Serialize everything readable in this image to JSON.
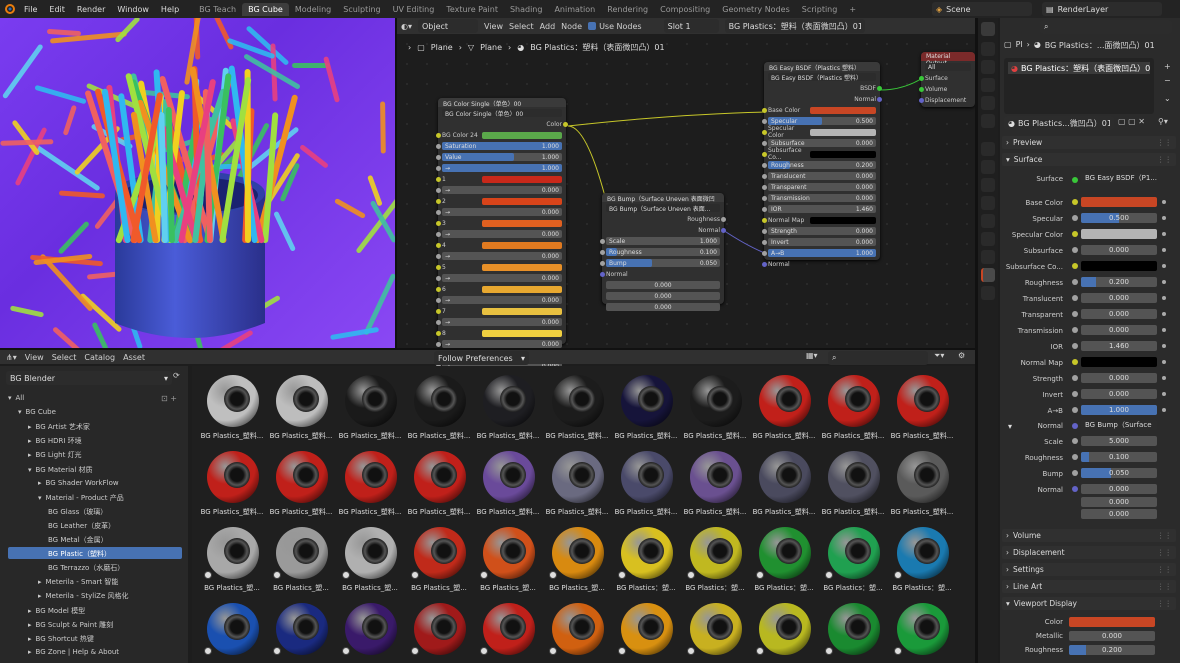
{
  "topbar": {
    "menus": [
      "File",
      "Edit",
      "Render",
      "Window",
      "Help"
    ],
    "tabs": [
      "BG Teach",
      "BG Cube",
      "Modeling",
      "Sculpting",
      "UV Editing",
      "Texture Paint",
      "Shading",
      "Animation",
      "Rendering",
      "Compositing",
      "Geometry Nodes",
      "Scripting"
    ],
    "add_tab": "+",
    "scene": "Scene",
    "render_layer": "RenderLayer"
  },
  "node_header": {
    "object_mode": "Object",
    "view": "View",
    "select": "Select",
    "add": "Add",
    "node": "Node",
    "use_nodes": "Use Nodes",
    "slot": "Slot 1",
    "material": "BG Plastics：塑料（表面微凹凸）01"
  },
  "breadcrumb": [
    "Plane",
    "Plane",
    "BG Plastics：塑料（表面微凹凸）01"
  ],
  "nodes": {
    "color_single": {
      "title": "BG Color Single（单色）00",
      "sub": "BG Color Single（单色）00",
      "out": "Color",
      "color_label": "BG Color 24",
      "rows": [
        [
          "Saturation",
          "1.000"
        ],
        [
          "Value",
          "1.000"
        ],
        [
          "→",
          "1.000"
        ]
      ],
      "idx": [
        "1",
        "2",
        "3",
        "4",
        "5",
        "6",
        "7",
        "8",
        "9"
      ],
      "zero": "0.000"
    },
    "bump": {
      "title": "BG Bump（Surface Uneven 表面微凹凸）",
      "sub": "BG Bump（Surface Uneven 表面...",
      "out1": "Roughness",
      "out2": "Normal",
      "rows": [
        [
          "Scale",
          "1.000"
        ],
        [
          "Roughness",
          "0.100"
        ],
        [
          "Bump",
          "0.050"
        ]
      ],
      "normal": "Normal",
      "n1": "0.000",
      "n2": "0.000",
      "n3": "0.000"
    },
    "bsdf": {
      "title": "BG Easy BSDF（Plastics 塑料）",
      "sub": "BG Easy BSDF（Plastics 塑料）",
      "out1": "BSDF",
      "out2": "Normal",
      "rows": [
        [
          "Base Color",
          ""
        ],
        [
          "Specular",
          "0.500"
        ],
        [
          "Specular Color",
          ""
        ],
        [
          "Subsurface",
          "0.000"
        ],
        [
          "Subsurface Co...",
          ""
        ],
        [
          "Roughness",
          "0.200"
        ],
        [
          "Translucent",
          "0.000"
        ],
        [
          "Transparent",
          "0.000"
        ],
        [
          "Transmission",
          "0.000"
        ],
        [
          "IOR",
          "1.460"
        ],
        [
          "Normal Map",
          ""
        ],
        [
          "Strength",
          "0.000"
        ],
        [
          "Invert",
          "0.000"
        ],
        [
          "A→B",
          "1.000"
        ],
        [
          "Normal",
          ""
        ]
      ]
    },
    "output": {
      "title": "Material Output",
      "target": "All",
      "s1": "Surface",
      "s2": "Volume",
      "s3": "Displacement"
    }
  },
  "asset_header": {
    "view": "View",
    "select": "Select",
    "catalog": "Catalog",
    "asset": "Asset",
    "follow": "Follow Preferences"
  },
  "asset_side": {
    "library": "BG Blender",
    "tree": [
      "All",
      "BG Cube",
      "BG Artist 艺术家",
      "BG HDRI 环境",
      "BG Light 灯光",
      "BG Material 材质",
      "BG Shader WorkFlow",
      "Material - Product 产品",
      "BG Glass（玻璃）",
      "BG Leather（皮革）",
      "BG Metal（金属）",
      "BG Plastic（塑料）",
      "BG Terrazzo（水磨石）",
      "Meterila - Smart 智能",
      "Meterila - StyliZe 风格化",
      "BG Model 模型",
      "BG Sculpt & Paint 雕刻",
      "BG Shortcut 热键",
      "BG Zone | Help & About"
    ]
  },
  "assets": {
    "long_label": "BG Plastics_塑料...",
    "short_label": "BG Plastics_塑...",
    "colon_label": "BG Plastics：塑...",
    "colors": [
      "#bfbfbf",
      "#bdbdbd",
      "#1a1a1a",
      "#1a1a1a",
      "#1e1e22",
      "#1c1c1c",
      "#16143a",
      "#1c1c1c",
      "#c1201a",
      "#c0201a",
      "#c0201a",
      "#c0201a",
      "#c0201a",
      "#c0201a",
      "#c0201a",
      "#6a4a9a",
      "#6a6a80",
      "#4a4a6a",
      "#6a5090",
      "#4a4a5e",
      "#505060",
      "#5a5a5a",
      "#a8a8a8",
      "#9a9a9a",
      "#b0b0b0",
      "#c02a1a",
      "#d0501a",
      "#d88a10",
      "#d8c020",
      "#c0b820",
      "#209030",
      "#20a050",
      "#1a7ab0",
      "#1a50b0",
      "#1a2a80",
      "#3a1a6a",
      "#a01a1a",
      "#c0201a",
      "#d06010",
      "#d89010",
      "#c8b020",
      "#b8b820",
      "#1a8a30",
      "#1a9a3a"
    ]
  },
  "props": {
    "obj": "Pl",
    "mat": "BG Plastics：...面微凹凸）01",
    "slot": "BG Plastics：塑料（表面微凹凸）01",
    "mat2": "BG Plastics...微凹凸）01",
    "preview": "Preview",
    "surface_hdr": "Surface",
    "surface": "Surface",
    "surface_val": "BG Easy BSDF（P1...",
    "rows": [
      [
        "Base Color",
        ""
      ],
      [
        "Specular",
        "0.500"
      ],
      [
        "Specular Color",
        ""
      ],
      [
        "Subsurface",
        "0.000"
      ],
      [
        "Subsurface Co...",
        ""
      ],
      [
        "Roughness",
        "0.200"
      ],
      [
        "Translucent",
        "0.000"
      ],
      [
        "Transparent",
        "0.000"
      ],
      [
        "Transmission",
        "0.000"
      ],
      [
        "IOR",
        "1.460"
      ],
      [
        "Normal Map",
        ""
      ],
      [
        "Strength",
        "0.000"
      ],
      [
        "Invert",
        "0.000"
      ],
      [
        "A→B",
        "1.000"
      ]
    ],
    "normal_label": "Normal",
    "normal_val": "BG Bump（Surface ...",
    "bump_rows": [
      [
        "Scale",
        "5.000"
      ],
      [
        "Roughness",
        "0.100"
      ],
      [
        "Bump",
        "0.050"
      ],
      [
        "Normal",
        "0.000"
      ]
    ],
    "n2": "0.000",
    "n3": "0.000",
    "sections": [
      "Volume",
      "Displacement",
      "Settings",
      "Line Art",
      "Viewport Display"
    ],
    "vp_rows": [
      [
        "Color",
        ""
      ],
      [
        "Metallic",
        "0.000"
      ],
      [
        "Roughness",
        "0.200"
      ]
    ]
  },
  "colors": {
    "accent": "#4772b3",
    "base": "#c84624",
    "specular": "#b4b4b4"
  }
}
